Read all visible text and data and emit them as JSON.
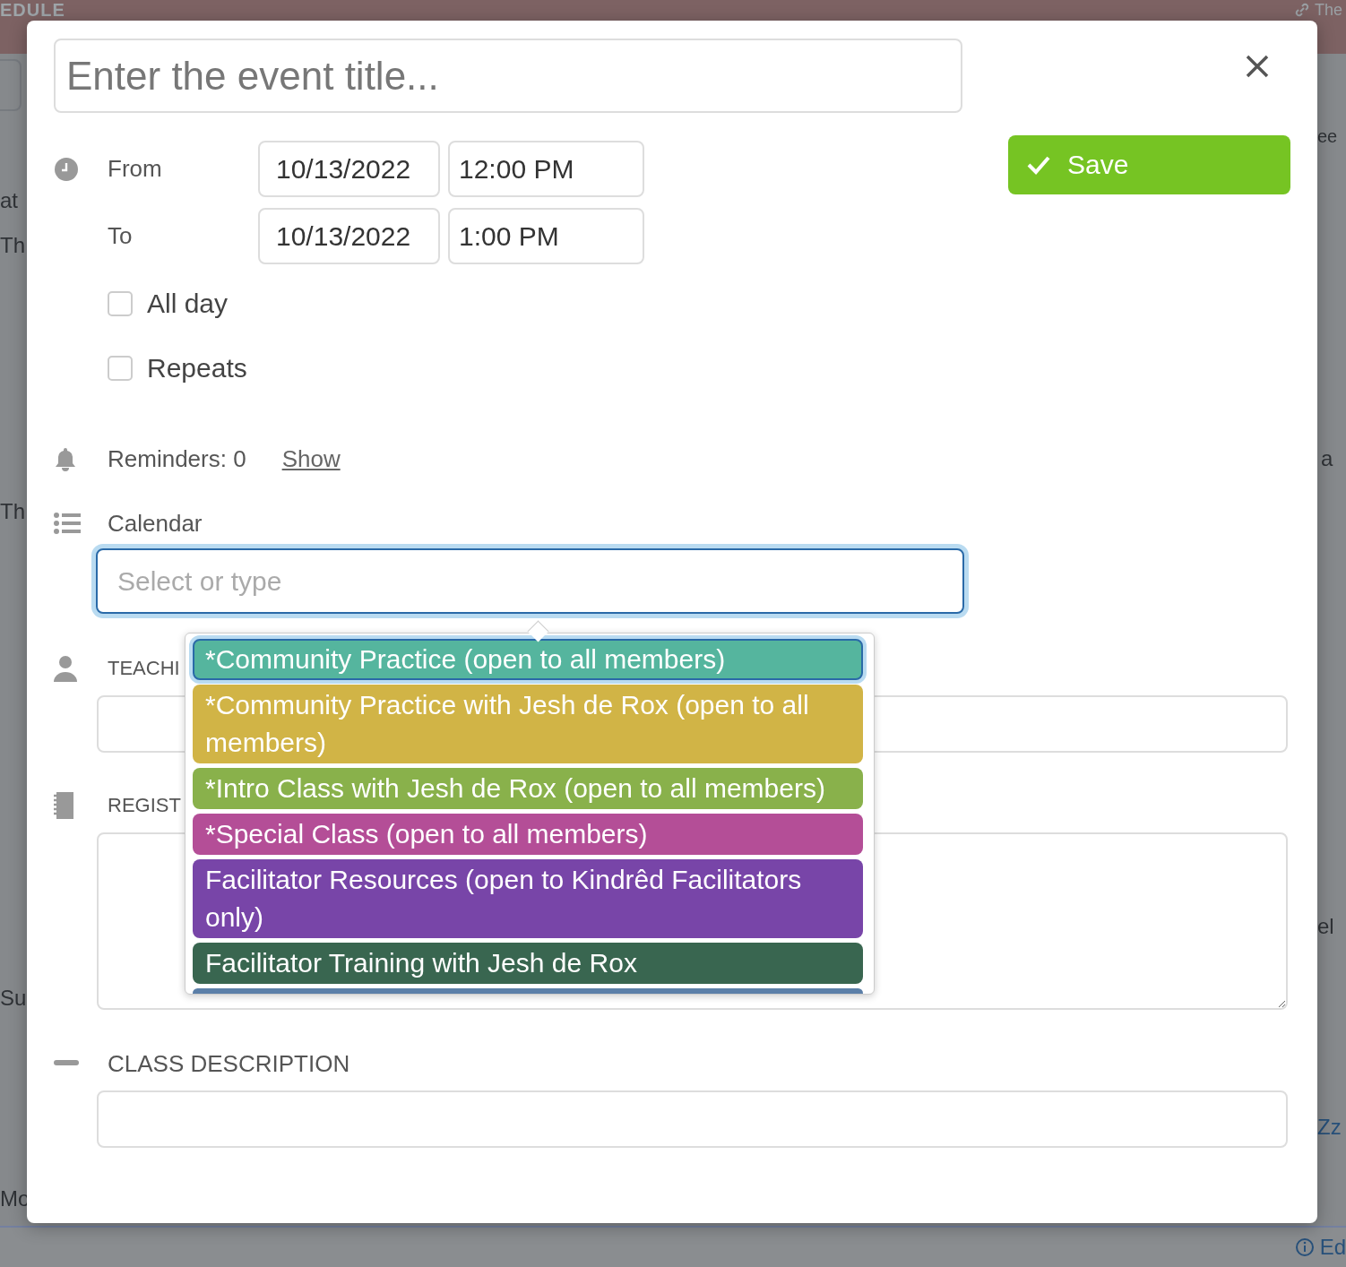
{
  "background": {
    "heading": "EDULE",
    "top_right": "The",
    "left_fragments": [
      "at",
      "Th",
      "Th",
      "Su",
      "Mo"
    ],
    "right_fragments": [
      "ee",
      "a",
      "el",
      "Zz"
    ],
    "footer": "Ed"
  },
  "dialog": {
    "title_placeholder": "Enter the event title...",
    "save": "Save",
    "from": {
      "label": "From",
      "date": "10/13/2022",
      "time": "12:00 PM"
    },
    "to": {
      "label": "To",
      "date": "10/13/2022",
      "time": "1:00 PM"
    },
    "checkboxes": [
      {
        "label": "All day",
        "checked": false
      },
      {
        "label": "Repeats",
        "checked": false
      }
    ],
    "reminders": {
      "label": "Reminders: 0",
      "link": "Show"
    },
    "calendar": {
      "label": "Calendar",
      "placeholder": "Select or type",
      "focused": true
    },
    "teacher_label": "TEACHI",
    "registration_label": "REGIST",
    "description_label": "CLASS DESCRIPTION"
  },
  "calendar_options": [
    {
      "label": "*Community Practice (open to all members)",
      "color": "#55b59e",
      "selected": true
    },
    {
      "label": "*Community Practice with Jesh de Rox (open to all members)",
      "color": "#d1b446",
      "selected": false
    },
    {
      "label": "*Intro Class with Jesh de Rox (open to all members)",
      "color": "#89b14b",
      "selected": false
    },
    {
      "label": "*Special Class (open to all members)",
      "color": "#b44e97",
      "selected": false
    },
    {
      "label": "Facilitator Resources (open to Kindrêd Facilitators only)",
      "color": "#7845a8",
      "selected": false
    },
    {
      "label": "Facilitator Training with Jesh de Rox",
      "color": "#396650",
      "selected": false
    },
    {
      "color": "#5b7fa8",
      "selected": false
    }
  ]
}
